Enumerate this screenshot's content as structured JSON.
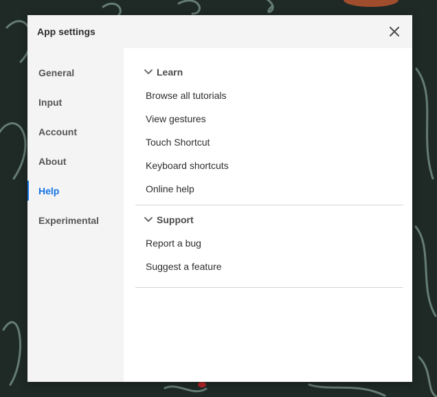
{
  "dialog": {
    "title": "App settings"
  },
  "sidebar": {
    "items": [
      {
        "label": "General"
      },
      {
        "label": "Input"
      },
      {
        "label": "Account"
      },
      {
        "label": "About"
      },
      {
        "label": "Help",
        "active": true
      },
      {
        "label": "Experimental"
      }
    ]
  },
  "help": {
    "learn": {
      "title": "Learn",
      "links": [
        "Browse all tutorials",
        "View gestures",
        "Touch Shortcut",
        "Keyboard shortcuts",
        "Online help"
      ]
    },
    "support": {
      "title": "Support",
      "links": [
        "Report a bug",
        "Suggest a feature"
      ]
    }
  },
  "colors": {
    "accent": "#1473e6",
    "background": "#1f2a27",
    "panel": "#f4f4f4"
  },
  "icons": {
    "close": "close-icon",
    "chevron": "chevron-down-icon"
  }
}
